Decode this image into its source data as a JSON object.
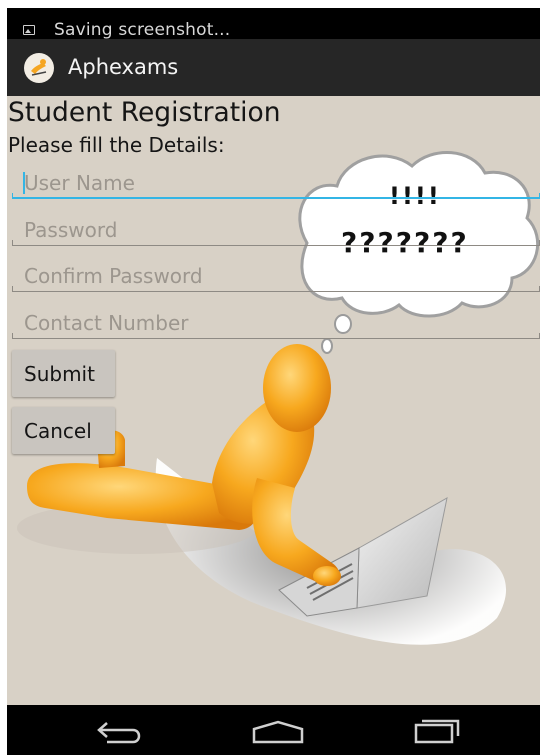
{
  "status_bar": {
    "notification_text": "Saving screenshot..."
  },
  "app_bar": {
    "title": "Aphexams"
  },
  "form": {
    "heading": "Student Registration",
    "subheading": "Please fill the Details:",
    "fields": [
      {
        "placeholder": "User Name",
        "value": ""
      },
      {
        "placeholder": "Password",
        "value": ""
      },
      {
        "placeholder": "Confirm Password",
        "value": ""
      },
      {
        "placeholder": "Contact Number",
        "value": ""
      }
    ],
    "submit_label": "Submit",
    "cancel_label": "Cancel"
  },
  "illustration": {
    "bubble_line1": "!!!!",
    "bubble_line2": "???????"
  },
  "colors": {
    "background": "#d8d1c6",
    "accent": "#33b5e5",
    "figure": "#f5a623"
  }
}
